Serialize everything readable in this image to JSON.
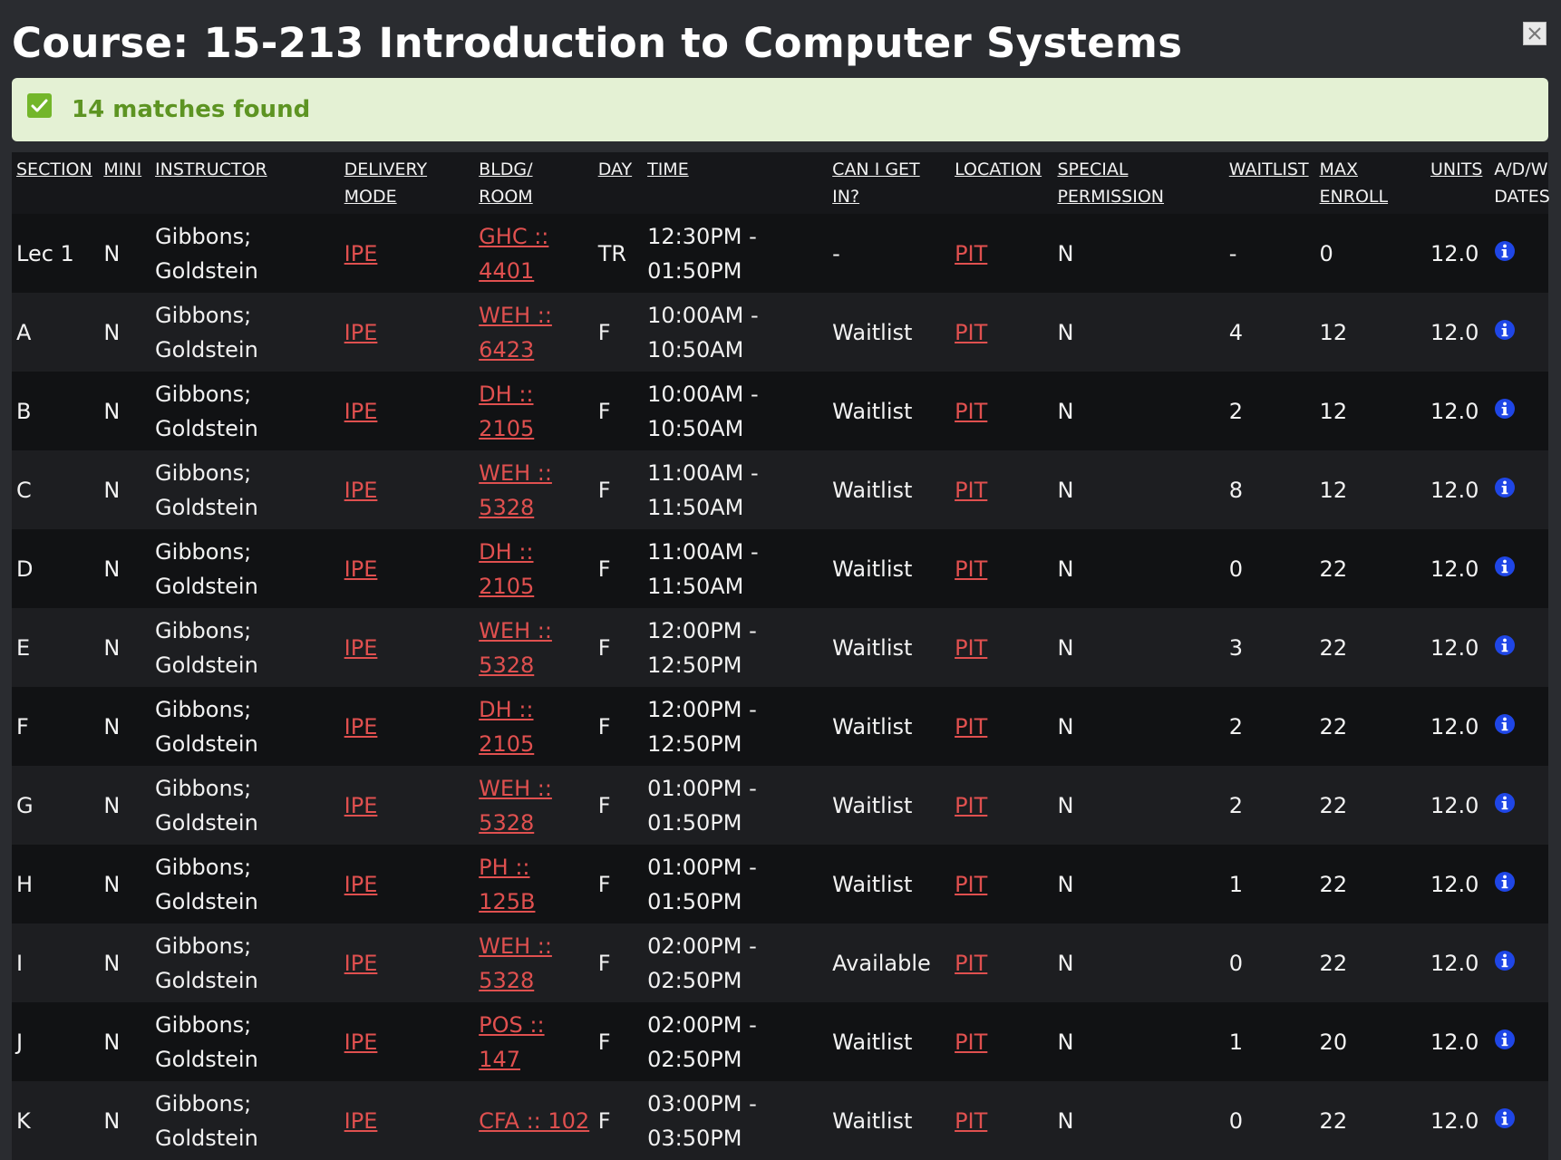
{
  "title": "Course: 15-213 Introduction to Computer Systems",
  "close_icon": "close-icon",
  "notice": {
    "icon": "check-icon",
    "text": "14 matches found",
    "background": "#e4f1d4",
    "color": "#5d9422"
  },
  "headers": {
    "section": "SECTION",
    "mini": "MINI",
    "instructor": "INSTRUCTOR",
    "delivery_1": "DELIVERY",
    "delivery_2": "MODE",
    "bldg_1": "BLDG/",
    "bldg_2": "ROOM",
    "day": "DAY",
    "time": "TIME",
    "cangetin_1": "CAN I GET",
    "cangetin_2": "IN?",
    "location": "LOCATION",
    "special_1": "SPECIAL",
    "special_2": "PERMISSION",
    "waitlist": "WAITLIST",
    "maxenroll_1": "MAX",
    "maxenroll_2": "ENROLL",
    "units": "UNITS",
    "adw_1": "A/D/W",
    "adw_2": "DATES"
  },
  "link_color": "#e0504f",
  "info_icon": "info-icon",
  "rows": [
    {
      "section": "Lec 1",
      "mini": "N",
      "instructor_1": "Gibbons;",
      "instructor_2": "Goldstein",
      "delivery": "IPE",
      "bldg_1": "GHC ::",
      "bldg_2": "4401",
      "day": "TR",
      "time_1": "12:30PM -",
      "time_2": "01:50PM",
      "cangetin": "-",
      "location": "PIT",
      "special": "N",
      "waitlist": "-",
      "maxenroll": "0",
      "units": "12.0"
    },
    {
      "section": "A",
      "mini": "N",
      "instructor_1": "Gibbons;",
      "instructor_2": "Goldstein",
      "delivery": "IPE",
      "bldg_1": "WEH ::",
      "bldg_2": "6423",
      "day": "F",
      "time_1": "10:00AM -",
      "time_2": "10:50AM",
      "cangetin": "Waitlist",
      "location": "PIT",
      "special": "N",
      "waitlist": "4",
      "maxenroll": "12",
      "units": "12.0"
    },
    {
      "section": "B",
      "mini": "N",
      "instructor_1": "Gibbons;",
      "instructor_2": "Goldstein",
      "delivery": "IPE",
      "bldg_1": "DH ::",
      "bldg_2": "2105",
      "day": "F",
      "time_1": "10:00AM -",
      "time_2": "10:50AM",
      "cangetin": "Waitlist",
      "location": "PIT",
      "special": "N",
      "waitlist": "2",
      "maxenroll": "12",
      "units": "12.0"
    },
    {
      "section": "C",
      "mini": "N",
      "instructor_1": "Gibbons;",
      "instructor_2": "Goldstein",
      "delivery": "IPE",
      "bldg_1": "WEH ::",
      "bldg_2": "5328",
      "day": "F",
      "time_1": "11:00AM -",
      "time_2": "11:50AM",
      "cangetin": "Waitlist",
      "location": "PIT",
      "special": "N",
      "waitlist": "8",
      "maxenroll": "12",
      "units": "12.0"
    },
    {
      "section": "D",
      "mini": "N",
      "instructor_1": "Gibbons;",
      "instructor_2": "Goldstein",
      "delivery": "IPE",
      "bldg_1": "DH ::",
      "bldg_2": "2105",
      "day": "F",
      "time_1": "11:00AM -",
      "time_2": "11:50AM",
      "cangetin": "Waitlist",
      "location": "PIT",
      "special": "N",
      "waitlist": "0",
      "maxenroll": "22",
      "units": "12.0"
    },
    {
      "section": "E",
      "mini": "N",
      "instructor_1": "Gibbons;",
      "instructor_2": "Goldstein",
      "delivery": "IPE",
      "bldg_1": "WEH ::",
      "bldg_2": "5328",
      "day": "F",
      "time_1": "12:00PM -",
      "time_2": "12:50PM",
      "cangetin": "Waitlist",
      "location": "PIT",
      "special": "N",
      "waitlist": "3",
      "maxenroll": "22",
      "units": "12.0"
    },
    {
      "section": "F",
      "mini": "N",
      "instructor_1": "Gibbons;",
      "instructor_2": "Goldstein",
      "delivery": "IPE",
      "bldg_1": "DH ::",
      "bldg_2": "2105",
      "day": "F",
      "time_1": "12:00PM -",
      "time_2": "12:50PM",
      "cangetin": "Waitlist",
      "location": "PIT",
      "special": "N",
      "waitlist": "2",
      "maxenroll": "22",
      "units": "12.0"
    },
    {
      "section": "G",
      "mini": "N",
      "instructor_1": "Gibbons;",
      "instructor_2": "Goldstein",
      "delivery": "IPE",
      "bldg_1": "WEH ::",
      "bldg_2": "5328",
      "day": "F",
      "time_1": "01:00PM -",
      "time_2": "01:50PM",
      "cangetin": "Waitlist",
      "location": "PIT",
      "special": "N",
      "waitlist": "2",
      "maxenroll": "22",
      "units": "12.0"
    },
    {
      "section": "H",
      "mini": "N",
      "instructor_1": "Gibbons;",
      "instructor_2": "Goldstein",
      "delivery": "IPE",
      "bldg_1": "PH ::",
      "bldg_2": "125B",
      "day": "F",
      "time_1": "01:00PM -",
      "time_2": "01:50PM",
      "cangetin": "Waitlist",
      "location": "PIT",
      "special": "N",
      "waitlist": "1",
      "maxenroll": "22",
      "units": "12.0"
    },
    {
      "section": "I",
      "mini": "N",
      "instructor_1": "Gibbons;",
      "instructor_2": "Goldstein",
      "delivery": "IPE",
      "bldg_1": "WEH ::",
      "bldg_2": "5328",
      "day": "F",
      "time_1": "02:00PM -",
      "time_2": "02:50PM",
      "cangetin": "Available",
      "location": "PIT",
      "special": "N",
      "waitlist": "0",
      "maxenroll": "22",
      "units": "12.0"
    },
    {
      "section": "J",
      "mini": "N",
      "instructor_1": "Gibbons;",
      "instructor_2": "Goldstein",
      "delivery": "IPE",
      "bldg_1": "POS ::",
      "bldg_2": "147",
      "day": "F",
      "time_1": "02:00PM -",
      "time_2": "02:50PM",
      "cangetin": "Waitlist",
      "location": "PIT",
      "special": "N",
      "waitlist": "1",
      "maxenroll": "20",
      "units": "12.0"
    },
    {
      "section": "K",
      "mini": "N",
      "instructor_1": "Gibbons;",
      "instructor_2": "Goldstein",
      "delivery": "IPE",
      "bldg_1": "CFA :: 102",
      "bldg_2": "",
      "day": "F",
      "time_1": "03:00PM -",
      "time_2": "03:50PM",
      "cangetin": "Waitlist",
      "location": "PIT",
      "special": "N",
      "waitlist": "0",
      "maxenroll": "22",
      "units": "12.0"
    }
  ]
}
